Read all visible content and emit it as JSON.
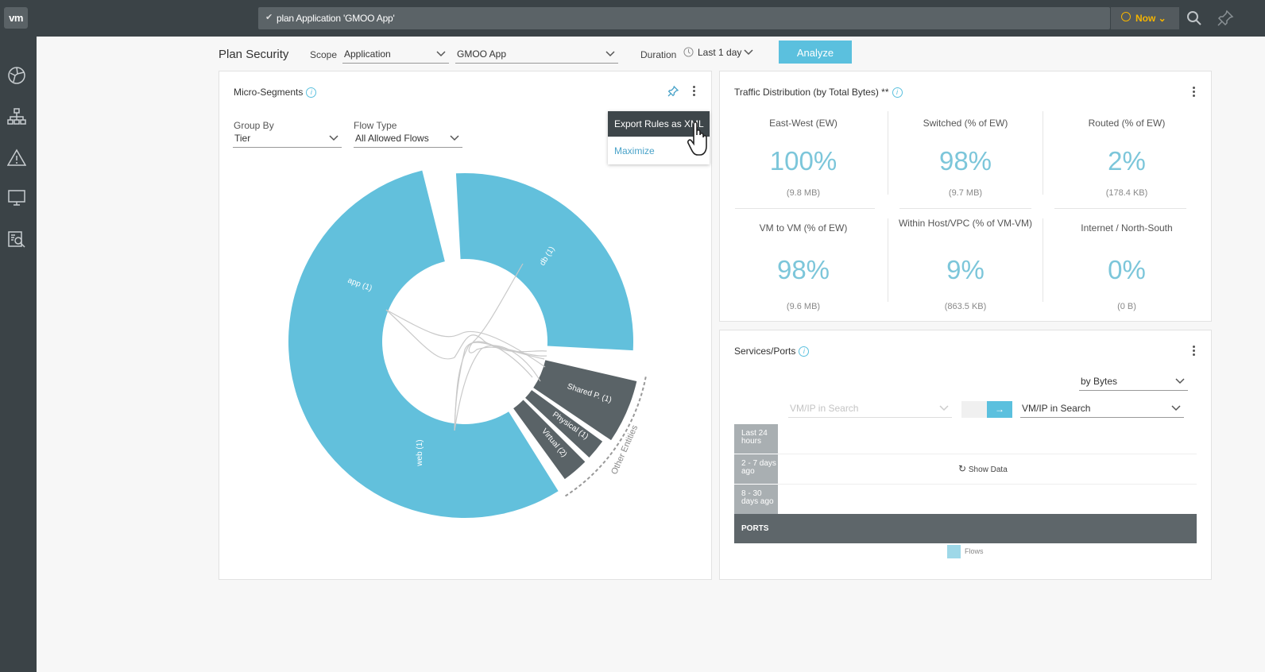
{
  "topbar": {
    "logo": "vm",
    "search_query": "plan Application 'GMOO App'",
    "time_label": "Now"
  },
  "sidebar": {
    "items": [
      "dashboard-icon",
      "topology-icon",
      "alert-icon",
      "monitor-icon",
      "search-report-icon"
    ]
  },
  "header": {
    "title": "Plan Security",
    "scope_label": "Scope",
    "scope_type": "Application",
    "scope_value": "GMOO App",
    "duration_label": "Duration",
    "duration_value": "Last 1 day",
    "analyze_label": "Analyze"
  },
  "micro_segments": {
    "title": "Micro-Segments",
    "group_by_label": "Group By",
    "group_by_value": "Tier",
    "flow_type_label": "Flow Type",
    "flow_type_value": "All Allowed Flows",
    "menu": {
      "export": "Export Rules as XML",
      "maximize": "Maximize"
    },
    "segments": [
      {
        "label": "db (1)"
      },
      {
        "label": "app (1)"
      },
      {
        "label": "web (1)"
      },
      {
        "label": "Shared P. (1)"
      },
      {
        "label": "Physical (1)"
      },
      {
        "label": "Virtual (2)"
      }
    ],
    "other_label": "Other Entities",
    "colors": {
      "tier": "#62c0dc",
      "other": "#5a6367"
    }
  },
  "traffic": {
    "title": "Traffic Distribution (by Total Bytes) **",
    "metrics": [
      {
        "label": "East-West (EW)",
        "value": "100%",
        "sub": "(9.8 MB)"
      },
      {
        "label": "Switched (% of EW)",
        "value": "98%",
        "sub": "(9.7 MB)"
      },
      {
        "label": "Routed (% of EW)",
        "value": "2%",
        "sub": "(178.4 KB)"
      },
      {
        "label": "VM to VM (% of EW)",
        "value": "98%",
        "sub": "(9.6 MB)"
      },
      {
        "label": "Within Host/VPC (% of VM-VM)",
        "value": "9%",
        "sub": "(863.5 KB)"
      },
      {
        "label": "Internet / North-South",
        "value": "0%",
        "sub": "(0 B)"
      }
    ]
  },
  "services": {
    "title": "Services/Ports",
    "sort_value": "by Bytes",
    "left_search_placeholder": "VM/IP in Search",
    "right_search_placeholder": "VM/IP in Search",
    "rows": [
      "Last 24 hours",
      "2 - 7 days ago",
      "8 - 30 days ago"
    ],
    "show_data": "Show Data",
    "ports_label": "PORTS",
    "legend": "Flows"
  }
}
